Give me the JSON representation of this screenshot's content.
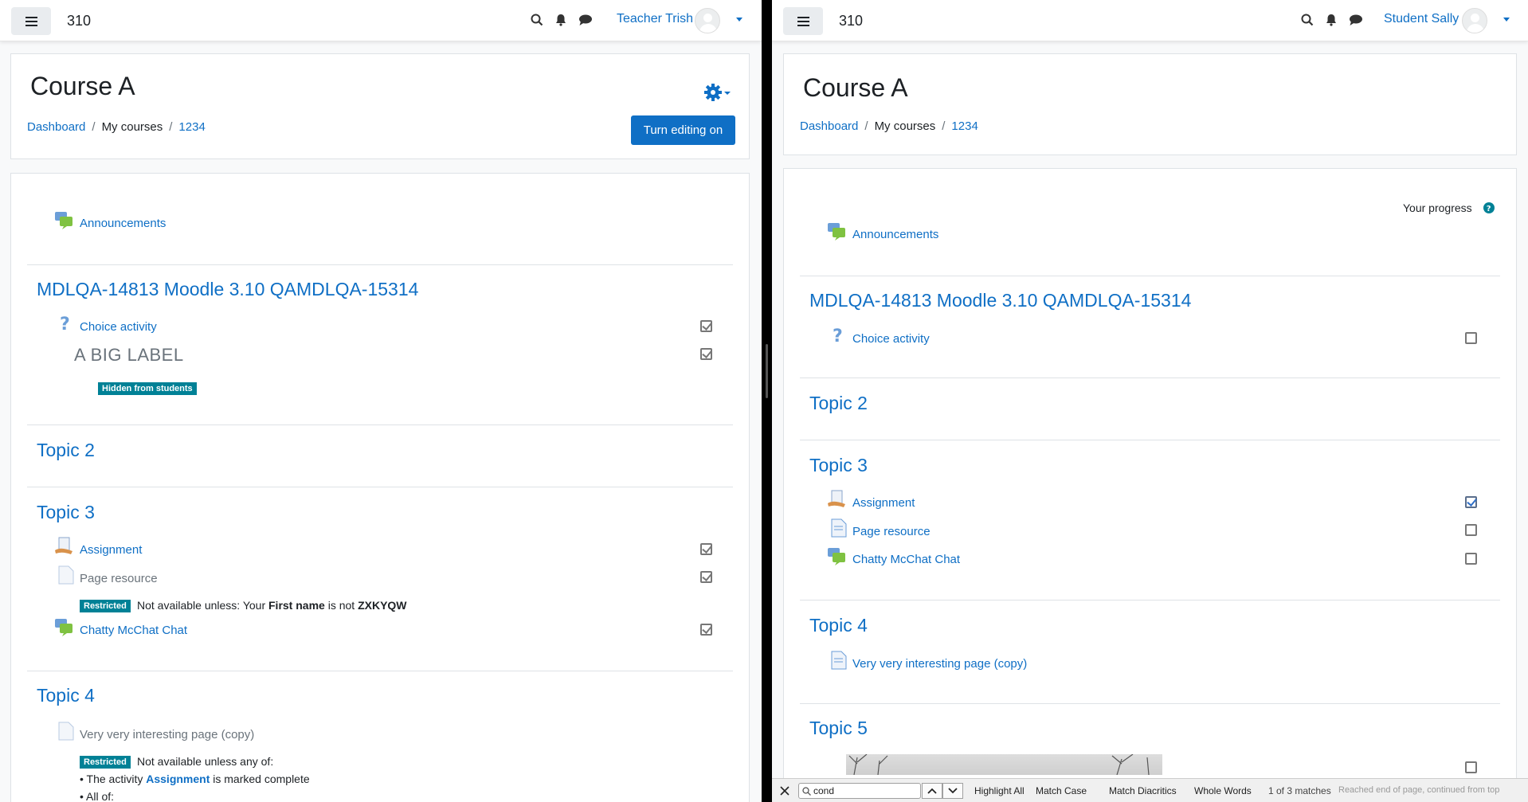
{
  "left": {
    "site_name": "310",
    "user_name": "Teacher Trish",
    "course_title": "Course A",
    "breadcrumb": [
      "Dashboard",
      "My courses",
      "1234"
    ],
    "turn_editing_label": "Turn editing on",
    "announcements": "Announcements",
    "section1": {
      "title": "MDLQA-14813 Moodle 3.10 QAMDLQA-15314",
      "choice": "Choice activity",
      "label": "A BIG LABEL",
      "hidden_badge": "Hidden from students"
    },
    "topic2": "Topic 2",
    "topic3": {
      "title": "Topic 3",
      "assignment": "Assignment",
      "page_resource": "Page resource",
      "restricted_badge": "Restricted",
      "restriction_text_1": "Not available unless: Your ",
      "restriction_bold_1": "First name",
      "restriction_text_2": " is not ",
      "restriction_bold_2": "ZXKYQW",
      "chat": "Chatty McChat Chat"
    },
    "topic4": {
      "title": "Topic 4",
      "page": "Very very interesting page (copy)",
      "restricted_badge": "Restricted",
      "restriction_text": "Not available unless any of:",
      "bullet1_pre": "The activity ",
      "bullet1_link": "Assignment",
      "bullet1_post": " is marked complete",
      "bullet2": "All of:"
    }
  },
  "right": {
    "site_name": "310",
    "user_name": "Student Sally",
    "course_title": "Course A",
    "breadcrumb": [
      "Dashboard",
      "My courses",
      "1234"
    ],
    "your_progress": "Your progress",
    "announcements": "Announcements",
    "section1": {
      "title": "MDLQA-14813 Moodle 3.10 QAMDLQA-15314",
      "choice": "Choice activity"
    },
    "topic2": "Topic 2",
    "topic3": {
      "title": "Topic 3",
      "assignment": "Assignment",
      "page_resource": "Page resource",
      "chat": "Chatty McChat Chat"
    },
    "topic4": {
      "title": "Topic 4",
      "page": "Very very interesting page (copy)"
    },
    "topic5": "Topic 5"
  },
  "findbar": {
    "query": "cond",
    "highlight_all": "Highlight All",
    "match_case": "Match Case",
    "match_diacritics": "Match Diacritics",
    "whole_words": "Whole Words",
    "matches": "1 of 3 matches",
    "status": "Reached end of page, continued from top"
  },
  "colors": {
    "link": "#0f6fc5",
    "primary_button": "#0f6fc5",
    "badge": "#008196"
  }
}
